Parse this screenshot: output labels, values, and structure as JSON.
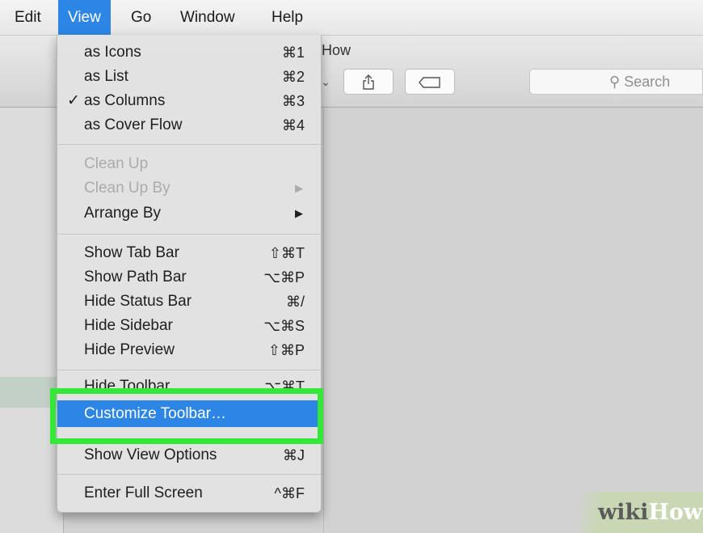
{
  "menubar": {
    "items": [
      "Edit",
      "View",
      "Go",
      "Window",
      "Help"
    ],
    "active": "View"
  },
  "window": {
    "title": "How",
    "search_placeholder": "Search",
    "search_icon": "magnifier-icon",
    "share_icon": "share-icon",
    "tag_icon": "tag-icon"
  },
  "menu": {
    "view_as": [
      {
        "label": "as Icons",
        "shortcut": "⌘1",
        "checked": false
      },
      {
        "label": "as List",
        "shortcut": "⌘2",
        "checked": false
      },
      {
        "label": "as Columns",
        "shortcut": "⌘3",
        "checked": true
      },
      {
        "label": "as Cover Flow",
        "shortcut": "⌘4",
        "checked": false
      }
    ],
    "checkmark": "✓",
    "arrange": [
      {
        "label": "Clean Up",
        "enabled": false
      },
      {
        "label": "Clean Up By",
        "enabled": false,
        "submenu_arrow": "▶"
      },
      {
        "label": "Arrange By",
        "enabled": true,
        "submenu_arrow": "▶"
      }
    ],
    "bars": [
      {
        "label": "Show Tab Bar",
        "shortcut": "⇧⌘T"
      },
      {
        "label": "Show Path Bar",
        "shortcut": "⌥⌘P"
      },
      {
        "label": "Hide Status Bar",
        "shortcut": "⌘/"
      },
      {
        "label": "Hide Sidebar",
        "shortcut": "⌥⌘S"
      },
      {
        "label": "Hide Preview",
        "shortcut": "⇧⌘P"
      }
    ],
    "toolbar": {
      "hide_label": "Hide Toolbar",
      "hide_shortcut": "⌥⌘T",
      "customize_label": "Customize Toolbar…",
      "options_label": "Show View Options",
      "options_shortcut": "⌘J"
    },
    "fullscreen": {
      "label": "Enter Full Screen",
      "shortcut": "^⌘F"
    }
  },
  "watermark": {
    "part1": "wiki",
    "part2": "How"
  },
  "colors": {
    "highlight": "#33e838",
    "selection": "#2d86e6"
  }
}
